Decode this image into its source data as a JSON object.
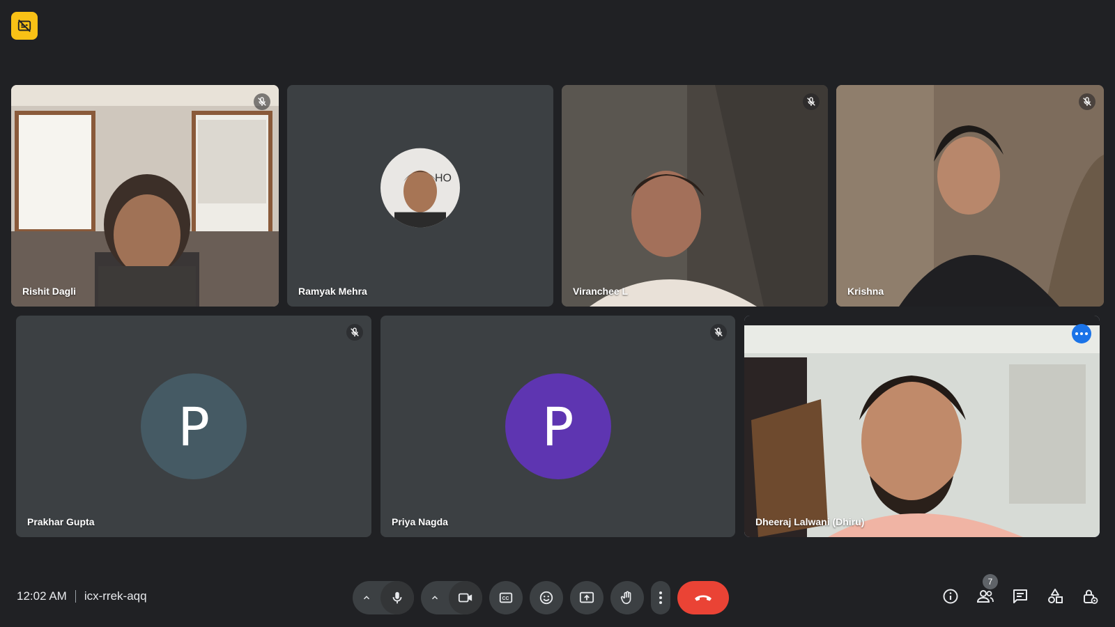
{
  "meeting": {
    "time": "12:02 AM",
    "code": "icx-rrek-aqq"
  },
  "participants": [
    {
      "name": "Rishit Dagli",
      "muted": true,
      "video": true
    },
    {
      "name": "Ramyak Mehra",
      "muted": false,
      "video": false,
      "avatar": "photo"
    },
    {
      "name": "Viranchee L",
      "muted": true,
      "video": true
    },
    {
      "name": "Krishna",
      "muted": true,
      "video": true
    },
    {
      "name": "Prakhar Gupta",
      "muted": true,
      "video": false,
      "avatar_letter": "P",
      "avatar_color": "#455a64"
    },
    {
      "name": "Priya Nagda",
      "muted": true,
      "video": false,
      "avatar_letter": "P",
      "avatar_color": "#5e35b1"
    },
    {
      "name": "Dheeraj Lalwani (Dhiru)",
      "muted": false,
      "video": true,
      "active": true
    }
  ],
  "people_count": "7",
  "colors": {
    "background": "#202124",
    "tile": "#3c4043",
    "end_call": "#ea4335",
    "accent": "#8ab4f8",
    "badge": "#f9c116"
  },
  "icons": {
    "top_badge": "captions-off-icon",
    "toolbar": [
      "chevron-up-icon",
      "mic-icon",
      "chevron-up-icon",
      "camera-icon",
      "captions-icon",
      "emoji-icon",
      "present-icon",
      "raise-hand-icon",
      "more-vert-icon",
      "end-call-icon"
    ],
    "right": [
      "info-icon",
      "people-icon",
      "chat-icon",
      "activities-icon",
      "host-controls-icon"
    ]
  }
}
